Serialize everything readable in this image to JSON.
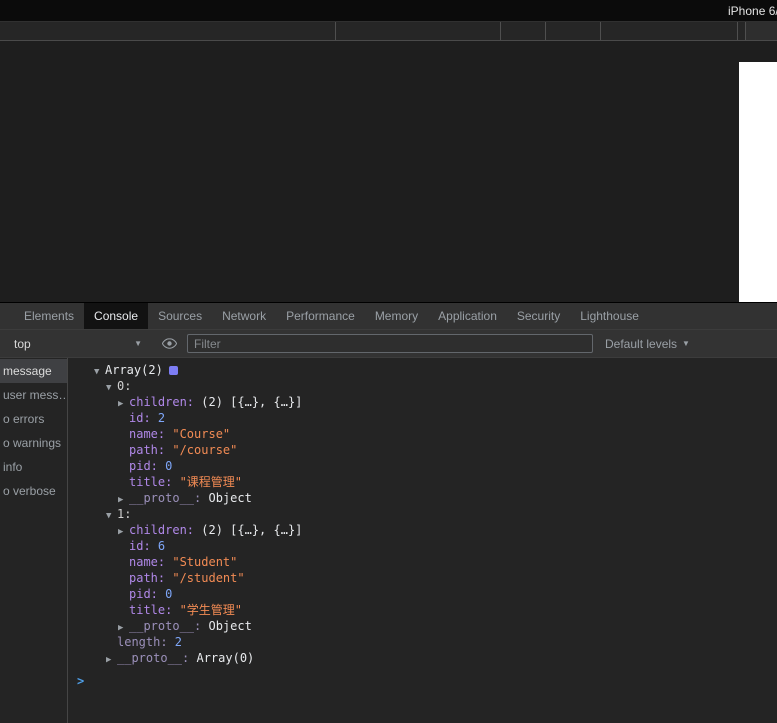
{
  "device_bar": {
    "label": "iPhone 6/"
  },
  "devtools": {
    "tabs": [
      {
        "label": "Elements",
        "selected": false
      },
      {
        "label": "Console",
        "selected": true
      },
      {
        "label": "Sources",
        "selected": false
      },
      {
        "label": "Network",
        "selected": false
      },
      {
        "label": "Performance",
        "selected": false
      },
      {
        "label": "Memory",
        "selected": false
      },
      {
        "label": "Application",
        "selected": false
      },
      {
        "label": "Security",
        "selected": false
      },
      {
        "label": "Lighthouse",
        "selected": false
      }
    ],
    "toolbar": {
      "context": "top",
      "filter_placeholder": "Filter",
      "filter_value": "",
      "levels": "Default levels"
    },
    "sidebar": {
      "items": [
        {
          "label": "message",
          "selected": true
        },
        {
          "label": "user mess…",
          "selected": false
        },
        {
          "label": "o errors",
          "selected": false
        },
        {
          "label": "o warnings",
          "selected": false
        },
        {
          "label": "info",
          "selected": false
        },
        {
          "label": "o verbose",
          "selected": false
        }
      ]
    },
    "console": {
      "prompt": ">",
      "rows": [
        {
          "indent": 0,
          "arrow": "▼",
          "value": "Array(2)",
          "valueType": "plain",
          "badge": true
        },
        {
          "indent": 1,
          "arrow": "▼",
          "key": "0",
          "keyType": "index"
        },
        {
          "indent": 2,
          "arrow": "▶",
          "key": "children",
          "keyType": "prop",
          "value": "(2) [{…}, {…}]",
          "valueType": "plain"
        },
        {
          "indent": 2,
          "key": "id",
          "keyType": "prop",
          "value": "2",
          "valueType": "number"
        },
        {
          "indent": 2,
          "key": "name",
          "keyType": "prop",
          "value": "\"Course\"",
          "valueType": "string"
        },
        {
          "indent": 2,
          "key": "path",
          "keyType": "prop",
          "value": "\"/course\"",
          "valueType": "string"
        },
        {
          "indent": 2,
          "key": "pid",
          "keyType": "prop",
          "value": "0",
          "valueType": "number"
        },
        {
          "indent": 2,
          "key": "title",
          "keyType": "prop",
          "value": "\"课程管理\"",
          "valueType": "string"
        },
        {
          "indent": 2,
          "arrow": "▶",
          "key": "__proto__",
          "keyType": "dim",
          "value": "Object",
          "valueType": "plain"
        },
        {
          "indent": 1,
          "arrow": "▼",
          "key": "1",
          "keyType": "index"
        },
        {
          "indent": 2,
          "arrow": "▶",
          "key": "children",
          "keyType": "prop",
          "value": "(2) [{…}, {…}]",
          "valueType": "plain"
        },
        {
          "indent": 2,
          "key": "id",
          "keyType": "prop",
          "value": "6",
          "valueType": "number"
        },
        {
          "indent": 2,
          "key": "name",
          "keyType": "prop",
          "value": "\"Student\"",
          "valueType": "string"
        },
        {
          "indent": 2,
          "key": "path",
          "keyType": "prop",
          "value": "\"/student\"",
          "valueType": "string"
        },
        {
          "indent": 2,
          "key": "pid",
          "keyType": "prop",
          "value": "0",
          "valueType": "number"
        },
        {
          "indent": 2,
          "key": "title",
          "keyType": "prop",
          "value": "\"学生管理\"",
          "valueType": "string"
        },
        {
          "indent": 2,
          "arrow": "▶",
          "key": "__proto__",
          "keyType": "dim",
          "value": "Object",
          "valueType": "plain"
        },
        {
          "indent": 1,
          "key": "length",
          "keyType": "dim",
          "value": "2",
          "valueType": "number"
        },
        {
          "indent": 1,
          "arrow": "▶",
          "key": "__proto__",
          "keyType": "dim",
          "value": "Array(0)",
          "valueType": "plain"
        }
      ]
    }
  },
  "colors": {
    "devtools_bg": "#242424",
    "toolbar_bg": "#333333",
    "key": "#b088e8",
    "key_dim": "#9b90ba",
    "string": "#f28b54",
    "number": "#7ea6f8",
    "badge": "#7d7df4",
    "prompt": "#4f9fe8"
  }
}
